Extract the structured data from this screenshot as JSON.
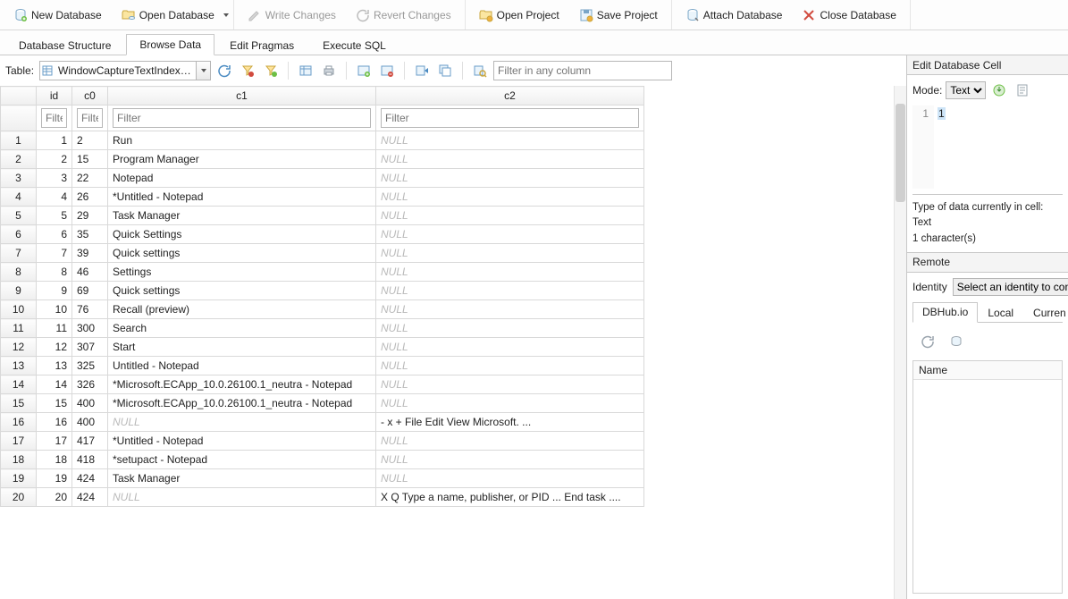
{
  "toolbar": {
    "new_db": "New Database",
    "open_db": "Open Database",
    "write": "Write Changes",
    "revert": "Revert Changes",
    "open_proj": "Open Project",
    "save_proj": "Save Project",
    "attach_db": "Attach Database",
    "close_db": "Close Database"
  },
  "tabs": {
    "structure": "Database Structure",
    "browse": "Browse Data",
    "pragmas": "Edit Pragmas",
    "sql": "Execute SQL"
  },
  "browse": {
    "table_label": "Table:",
    "table_selected": "WindowCaptureTextIndex_content",
    "filter_all_placeholder": "Filter in any column",
    "col_filter_placeholder": "Filter",
    "columns": [
      "id",
      "c0",
      "c1",
      "c2"
    ]
  },
  "rows": [
    {
      "n": "1",
      "id": "1",
      "c0": "2",
      "c1": "Run",
      "c2": null
    },
    {
      "n": "2",
      "id": "2",
      "c0": "15",
      "c1": "Program Manager",
      "c2": null
    },
    {
      "n": "3",
      "id": "3",
      "c0": "22",
      "c1": "Notepad",
      "c2": null
    },
    {
      "n": "4",
      "id": "4",
      "c0": "26",
      "c1": "*Untitled - Notepad",
      "c2": null
    },
    {
      "n": "5",
      "id": "5",
      "c0": "29",
      "c1": "Task Manager",
      "c2": null
    },
    {
      "n": "6",
      "id": "6",
      "c0": "35",
      "c1": "Quick Settings",
      "c2": null
    },
    {
      "n": "7",
      "id": "7",
      "c0": "39",
      "c1": "Quick settings",
      "c2": null
    },
    {
      "n": "8",
      "id": "8",
      "c0": "46",
      "c1": "Settings",
      "c2": null
    },
    {
      "n": "9",
      "id": "9",
      "c0": "69",
      "c1": "Quick settings",
      "c2": null
    },
    {
      "n": "10",
      "id": "10",
      "c0": "76",
      "c1": "Recall (preview)",
      "c2": null
    },
    {
      "n": "11",
      "id": "11",
      "c0": "300",
      "c1": "Search",
      "c2": null
    },
    {
      "n": "12",
      "id": "12",
      "c0": "307",
      "c1": "Start",
      "c2": null
    },
    {
      "n": "13",
      "id": "13",
      "c0": "325",
      "c1": "Untitled - Notepad",
      "c2": null
    },
    {
      "n": "14",
      "id": "14",
      "c0": "326",
      "c1": "*Microsoft.ECApp_10.0.26100.1_neutra - Notepad",
      "c2": null
    },
    {
      "n": "15",
      "id": "15",
      "c0": "400",
      "c1": "*Microsoft.ECApp_10.0.26100.1_neutra - Notepad",
      "c2": null
    },
    {
      "n": "16",
      "id": "16",
      "c0": "400",
      "c1": null,
      "c2": "- x + File Edit View Microsoft. ..."
    },
    {
      "n": "17",
      "id": "17",
      "c0": "417",
      "c1": "*Untitled - Notepad",
      "c2": null
    },
    {
      "n": "18",
      "id": "18",
      "c0": "418",
      "c1": "*setupact - Notepad",
      "c2": null
    },
    {
      "n": "19",
      "id": "19",
      "c0": "424",
      "c1": "Task Manager",
      "c2": null
    },
    {
      "n": "20",
      "id": "20",
      "c0": "424",
      "c1": null,
      "c2": "X Q Type a name, publisher, or PID ... End task ...."
    }
  ],
  "null_text": "NULL",
  "editcell": {
    "title": "Edit Database Cell",
    "mode_label": "Mode:",
    "mode_value": "Text",
    "line_no": "1",
    "content": "1",
    "type_line": "Type of data currently in cell: Text",
    "chars_line": "1 character(s)"
  },
  "remote": {
    "title": "Remote",
    "identity_label": "Identity",
    "identity_value": "Select an identity to con",
    "tabs": {
      "dbhub": "DBHub.io",
      "local": "Local",
      "current": "Curren"
    },
    "name_header": "Name"
  }
}
